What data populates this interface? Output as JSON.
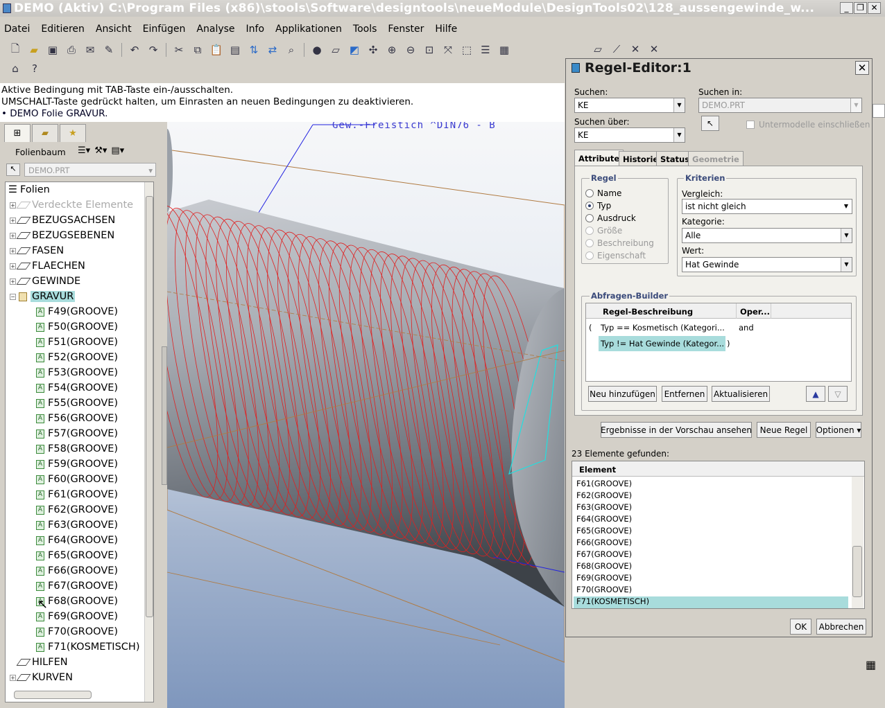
{
  "window": {
    "title": "DEMO (Aktiv) C:\\Program Files (x86)\\stools\\Software\\designtools\\neueModule\\DesignTools02\\128_aussengewinde_w..."
  },
  "menu": [
    "Datei",
    "Editieren",
    "Ansicht",
    "Einfügen",
    "Analyse",
    "Info",
    "Applikationen",
    "Tools",
    "Fenster",
    "Hilfe"
  ],
  "messages": [
    "Aktive Bedingung mit TAB-Taste ein-/ausschalten.",
    "UMSCHALT-Taste gedrückt halten, um Einrasten an neuen Bedingungen zu deaktivieren.",
    "• DEMO Folie GRAVUR."
  ],
  "leftpanel": {
    "title": "Folienbaum",
    "model": "DEMO.PRT"
  },
  "tree": {
    "root": "Folien",
    "top": [
      {
        "label": "Verdeckte Elemente",
        "dim": true
      },
      {
        "label": "BEZUGSACHSEN"
      },
      {
        "label": "BEZUGSEBENEN"
      },
      {
        "label": "FASEN"
      },
      {
        "label": "FLAECHEN"
      },
      {
        "label": "GEWINDE"
      },
      {
        "label": "GRAVUR",
        "selected": true
      }
    ],
    "children": [
      "F49(GROOVE)",
      "F50(GROOVE)",
      "F51(GROOVE)",
      "F52(GROOVE)",
      "F53(GROOVE)",
      "F54(GROOVE)",
      "F55(GROOVE)",
      "F56(GROOVE)",
      "F57(GROOVE)",
      "F58(GROOVE)",
      "F59(GROOVE)",
      "F60(GROOVE)",
      "F61(GROOVE)",
      "F62(GROOVE)",
      "F63(GROOVE)",
      "F64(GROOVE)",
      "F65(GROOVE)",
      "F66(GROOVE)",
      "F67(GROOVE)",
      "F68(GROOVE)",
      "F69(GROOVE)",
      "F70(GROOVE)",
      "F71(KOSMETISCH)"
    ],
    "bottom": [
      "HILFEN",
      "KURVEN"
    ]
  },
  "viewport": {
    "annotation": "Gew.-Freistich ^DIN76 - B"
  },
  "dialog": {
    "title": "Regel-Editor:1",
    "suchen_label": "Suchen:",
    "suchen_value": "KE",
    "suchen_in_label": "Suchen in:",
    "suchen_in_value": "DEMO.PRT",
    "suchen_ueber_label": "Suchen über:",
    "suchen_ueber_value": "KE",
    "untermodelle": "Untermodelle einschließen",
    "tabs": [
      "Attribute",
      "Historie",
      "Status",
      "Geometrie"
    ],
    "regel_title": "Regel",
    "regel_options": [
      "Name",
      "Typ",
      "Ausdruck",
      "Größe",
      "Beschreibung",
      "Eigenschaft"
    ],
    "kriterien_title": "Kriterien",
    "vergleich_label": "Vergleich:",
    "vergleich_value": "ist nicht gleich",
    "kategorie_label": "Kategorie:",
    "kategorie_value": "Alle",
    "wert_label": "Wert:",
    "wert_value": "Hat Gewinde",
    "abfrage_title": "Abfragen-Builder",
    "abfrage_cols": [
      "Regel-Beschreibung",
      "Oper..."
    ],
    "rule1": {
      "open": "(",
      "text": "Typ  ==  Kosmetisch (Kategori...",
      "op": "and"
    },
    "rule2": {
      "text": "Typ  !=  Hat Gewinde (Kategor...",
      "close": ")"
    },
    "btn_neu": "Neu hinzufügen",
    "btn_entfernen": "Entfernen",
    "btn_aktualisieren": "Aktualisieren",
    "btn_vorschau": "Ergebnisse in der Vorschau ansehen",
    "btn_neue_regel": "Neue Regel",
    "btn_optionen": "Optionen",
    "found": "23 Elemente gefunden:",
    "results_header": "Element",
    "results": [
      "F61(GROOVE)",
      "F62(GROOVE)",
      "F63(GROOVE)",
      "F64(GROOVE)",
      "F65(GROOVE)",
      "F66(GROOVE)",
      "F67(GROOVE)",
      "F68(GROOVE)",
      "F69(GROOVE)",
      "F70(GROOVE)",
      "F71(KOSMETISCH)"
    ],
    "btn_ok": "OK",
    "btn_abbrechen": "Abbrechen"
  }
}
